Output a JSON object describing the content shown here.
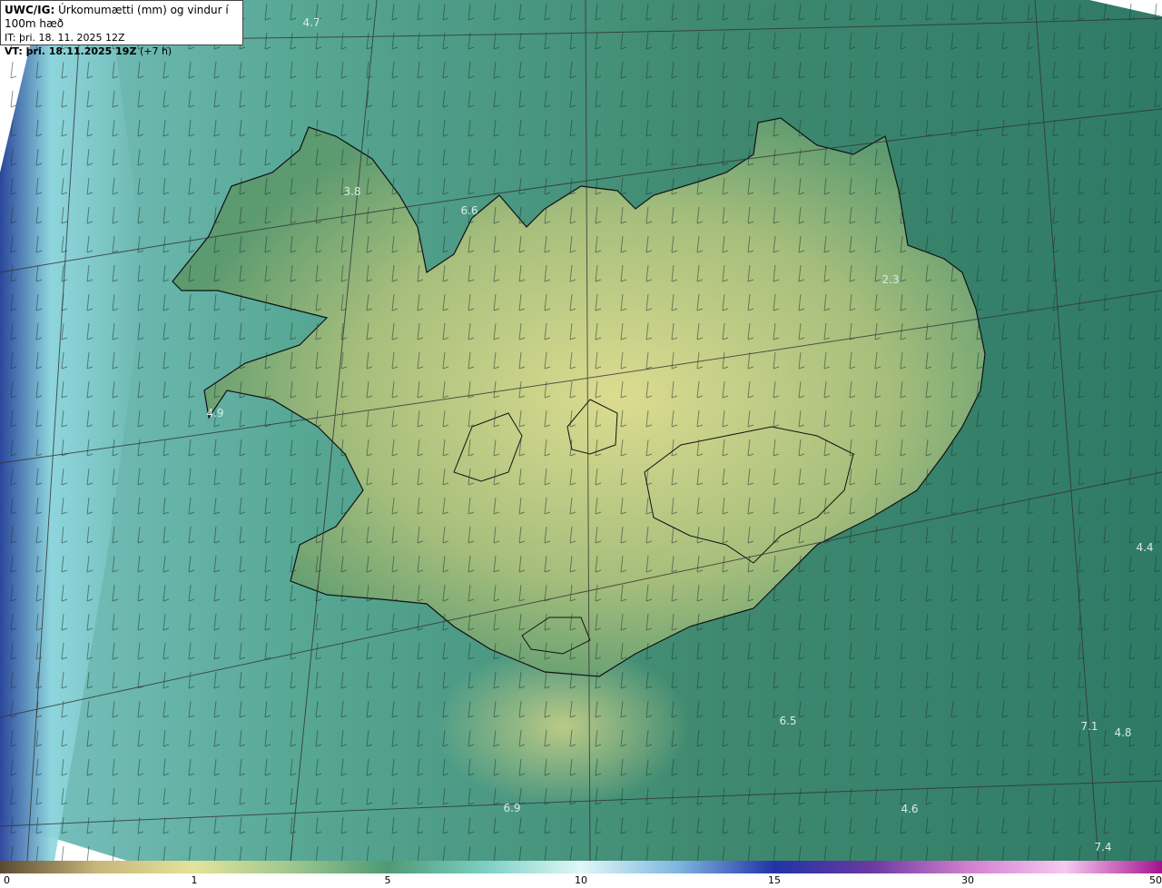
{
  "header": {
    "model_label": "UWC/IG:",
    "product_title": "Úrkomumætti (mm) og vindur í 100m hæð",
    "init_time": "IT: þri. 18. 11. 2025 12Z",
    "valid_prefix": "VT: þri. 18.11.2025 19Z",
    "lead_time": "(+7 h)"
  },
  "colors": {
    "ocean_deep": "#2c6e5e",
    "land_low": "#4f9a74",
    "land_high": "#d8da8c",
    "coast": "#111111",
    "grid": "#333333",
    "value_label": "#d8ecea"
  },
  "map_values": [
    "4.7",
    "3.8",
    "6.6",
    "2.3",
    "4.9",
    "4.4",
    "6.5",
    "7.1",
    "4.8",
    "6.9",
    "4.6",
    "7.4"
  ],
  "colorbar": {
    "ticks": [
      "0",
      "1",
      "5",
      "10",
      "15",
      "30",
      "50"
    ],
    "stops": [
      "#5a4a32",
      "#c9b679",
      "#e3e39a",
      "#9fc78e",
      "#4f9a74",
      "#7ccfc3",
      "#dff8f8",
      "#7fb6e0",
      "#2233a6",
      "#6a3aa0",
      "#d27fd0",
      "#f7c8f0",
      "#a3138f"
    ]
  }
}
